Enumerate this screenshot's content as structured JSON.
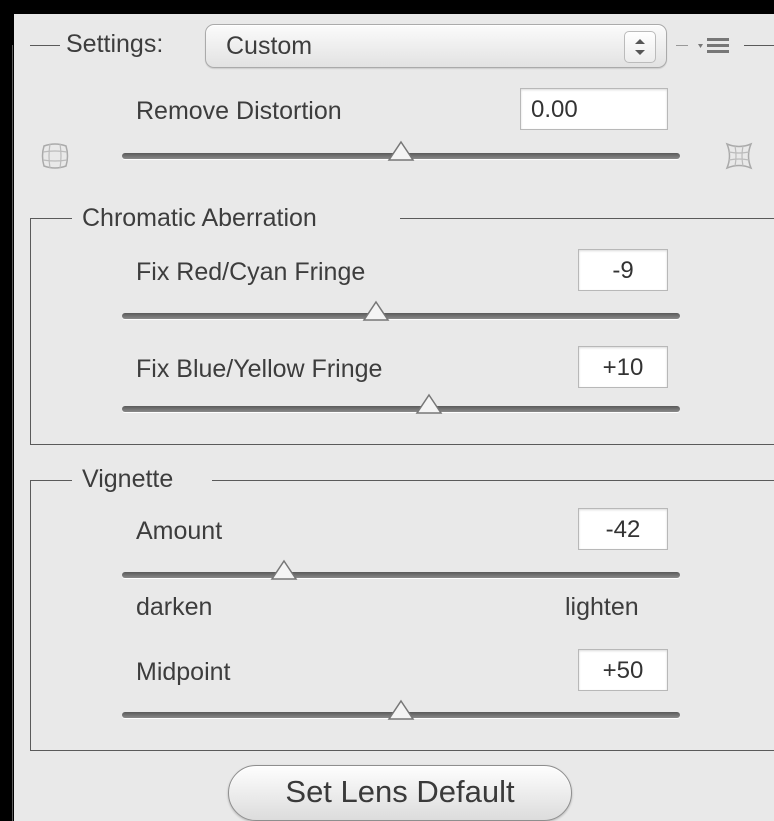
{
  "settings": {
    "label": "Settings:",
    "value": "Custom"
  },
  "remove_distortion": {
    "label": "Remove Distortion",
    "value": "0.00",
    "slider": 0.5
  },
  "chromatic_aberration": {
    "title": "Chromatic Aberration",
    "red_cyan": {
      "label": "Fix Red/Cyan Fringe",
      "value": "-9",
      "slider_value": -9,
      "range": [
        -100,
        100
      ]
    },
    "blue_yellow": {
      "label": "Fix Blue/Yellow Fringe",
      "value": "+10",
      "slider_value": 10,
      "range": [
        -100,
        100
      ]
    }
  },
  "vignette": {
    "title": "Vignette",
    "amount": {
      "label": "Amount",
      "value": "-42",
      "slider_value": -42,
      "range": [
        -100,
        100
      ]
    },
    "darken_label": "darken",
    "lighten_label": "lighten",
    "midpoint": {
      "label": "Midpoint",
      "value": "+50",
      "slider_value": 50,
      "range": [
        0,
        100
      ]
    }
  },
  "set_lens_default_label": "Set Lens Default",
  "icons": {
    "menu": "panel-menu-icon",
    "distort_left": "barrel-grid-icon",
    "distort_right": "pincushion-grid-icon"
  }
}
